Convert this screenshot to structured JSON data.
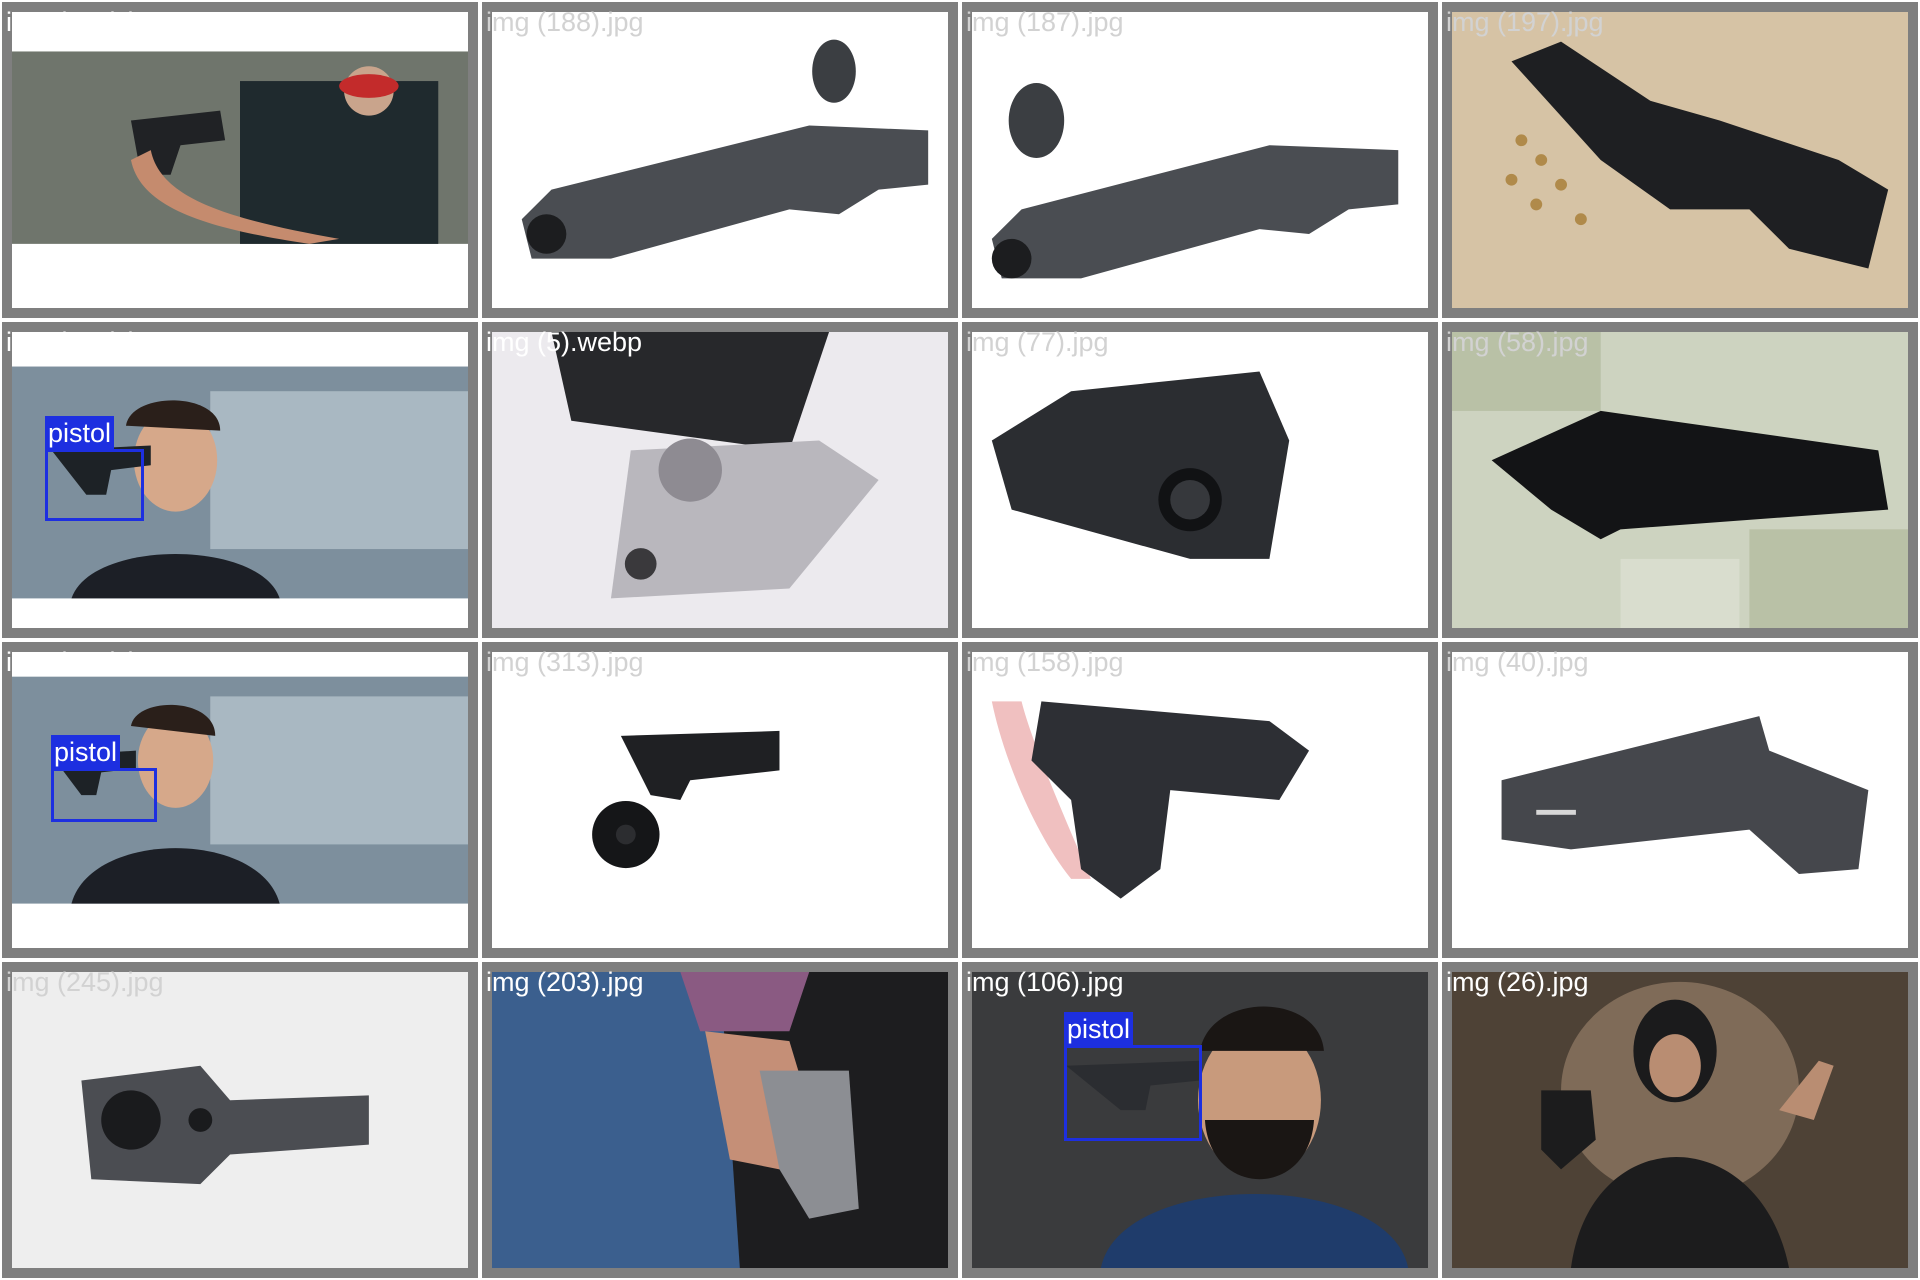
{
  "grid": {
    "cells": [
      {
        "filename": "img (180).jpg",
        "detections": []
      },
      {
        "filename": "img (188).jpg",
        "detections": []
      },
      {
        "filename": "img (187).jpg",
        "detections": []
      },
      {
        "filename": "img (197).jpg",
        "detections": []
      },
      {
        "filename": "img (108).jpg",
        "detections": [
          {
            "label": "pistol"
          }
        ]
      },
      {
        "filename": "img (5).webp",
        "detections": []
      },
      {
        "filename": "img (77).jpg",
        "detections": []
      },
      {
        "filename": "img (58).jpg",
        "detections": []
      },
      {
        "filename": "img (107).jpg",
        "detections": [
          {
            "label": "pistol"
          }
        ]
      },
      {
        "filename": "img (313).jpg",
        "detections": []
      },
      {
        "filename": "img (158).jpg",
        "detections": []
      },
      {
        "filename": "img (40).jpg",
        "detections": []
      },
      {
        "filename": "img (245).jpg",
        "detections": []
      },
      {
        "filename": "img (203).jpg",
        "detections": []
      },
      {
        "filename": "img (106).jpg",
        "detections": [
          {
            "label": "pistol"
          }
        ]
      },
      {
        "filename": "img (26).jpg",
        "detections": []
      }
    ]
  },
  "colors": {
    "tile_border": "#7f7f7f",
    "detection_box": "#1d2fe0"
  }
}
